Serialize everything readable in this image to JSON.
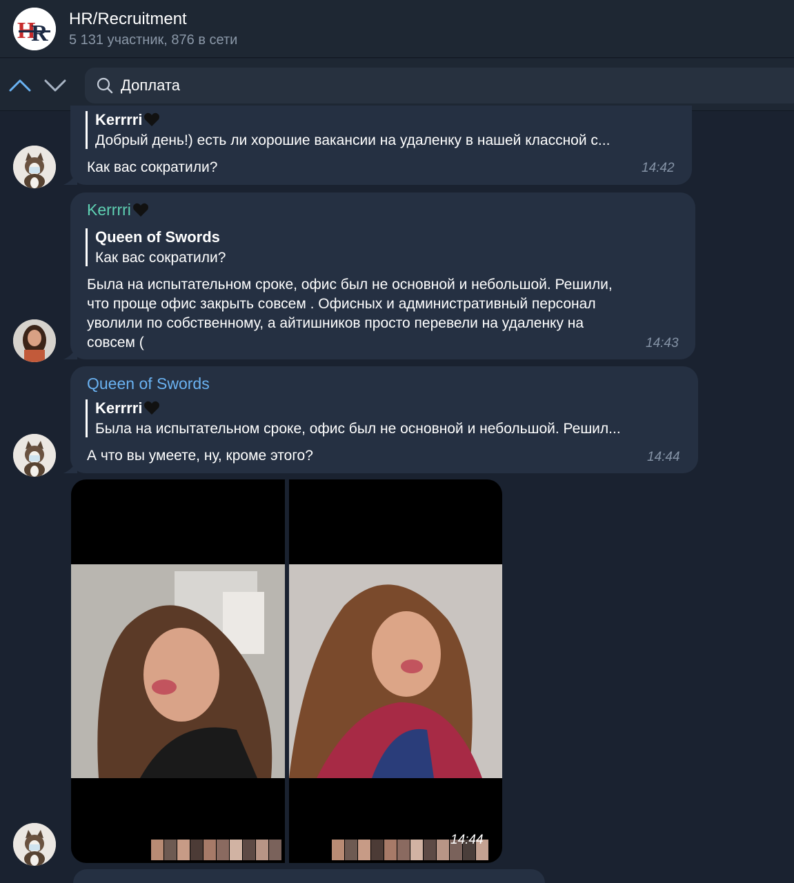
{
  "header": {
    "group_title": "HR/Recruitment",
    "group_subtitle": "5 131 участник, 876 в сети",
    "logo_text": "HR"
  },
  "search": {
    "query": "Доплата",
    "icons": {
      "search": "search-icon",
      "prev": "chevron-up-icon",
      "next": "chevron-down-icon"
    }
  },
  "messages": [
    {
      "reply_to": {
        "name": "Kerrrri",
        "text": "Добрый день!) есть ли хорошие вакансии на удаленку в нашей классной с..."
      },
      "text": "Как вас сократили?",
      "time": "14:42"
    },
    {
      "sender": "Kerrrri",
      "sender_color": "#5fd1b3",
      "reply_to": {
        "name": "Queen of Swords",
        "text": "Как вас сократили?"
      },
      "text_lines": [
        "Была на испытательном сроке, офис был не основной и небольшой. Решили,",
        "что проще офис закрыть совсем . Офисных и административный персонал",
        "уволили по собственному, а айтишников просто перевели на удаленку на",
        "совсем ("
      ],
      "time": "14:43"
    },
    {
      "sender": "Queen of Swords",
      "sender_color": "#6ab2f2",
      "reply_to": {
        "name": "Kerrrri",
        "text": "Была на испытательном сроке, офис был не основной и небольшой. Решил..."
      },
      "text": "А что вы умеете, ну, кроме этого?",
      "time": "14:44"
    },
    {
      "type": "photo_album",
      "photo_count": 2,
      "time": "14:44"
    }
  ],
  "colors": {
    "background": "#1a2230",
    "bubble": "#253042",
    "header": "#1e2733",
    "accent": "#6ab2f2"
  }
}
